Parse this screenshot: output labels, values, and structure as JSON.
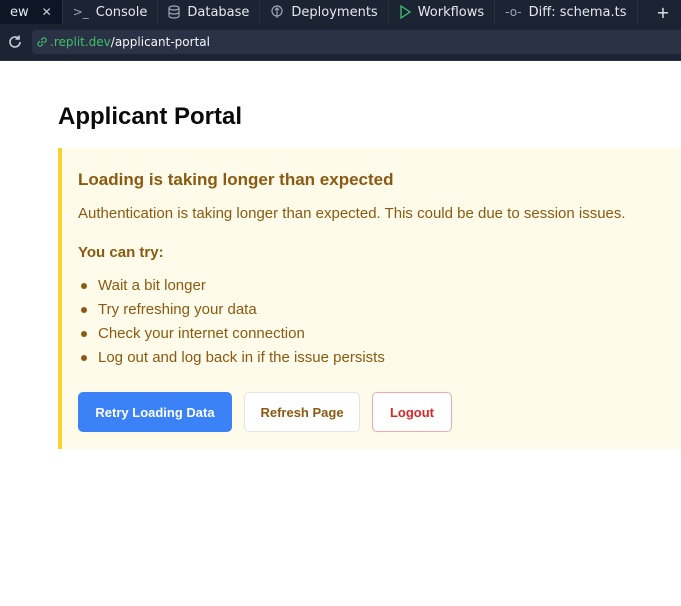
{
  "tabs": [
    {
      "label": "ew",
      "icon": "",
      "active": true,
      "has_close": true
    },
    {
      "label": "Console",
      "icon": "terminal-icon"
    },
    {
      "label": "Database",
      "icon": "database-icon"
    },
    {
      "label": "Deployments",
      "icon": "deployments-icon"
    },
    {
      "label": "Workflows",
      "icon": "play-icon"
    },
    {
      "label": "Diff: schema.ts",
      "icon": "commit-icon"
    }
  ],
  "url": {
    "host": ".replit.dev",
    "path": "/applicant-portal"
  },
  "page": {
    "title": "Applicant Portal"
  },
  "alert": {
    "heading": "Loading is taking longer than expected",
    "description": "Authentication is taking longer than expected. This could be due to session issues.",
    "subheading": "You can try:",
    "tips": [
      "Wait a bit longer",
      "Try refreshing your data",
      "Check your internet connection",
      "Log out and log back in if the issue persists"
    ]
  },
  "buttons": {
    "retry": "Retry Loading Data",
    "refresh": "Refresh Page",
    "logout": "Logout"
  },
  "colors": {
    "accent": "#3b82f6",
    "warning_border": "#fbd232",
    "warning_bg": "#fefbea",
    "warning_text": "#8b5a12",
    "danger": "#dc2626"
  }
}
